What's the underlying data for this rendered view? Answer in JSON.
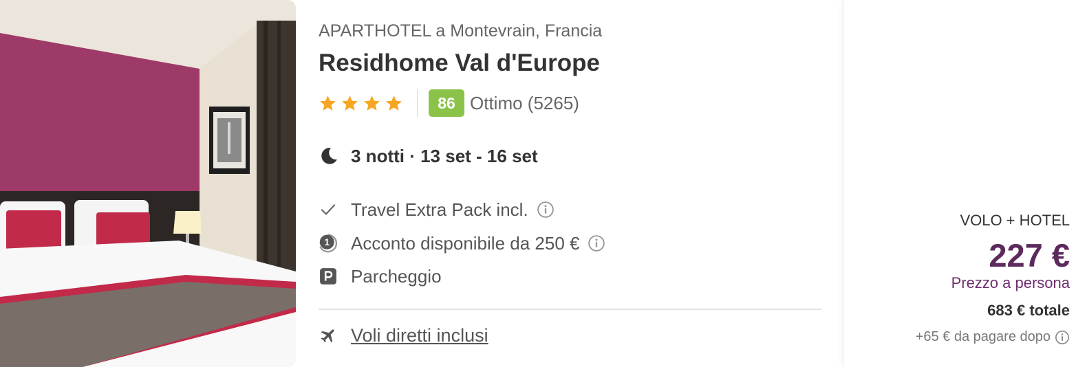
{
  "hotel": {
    "type_location": "APARTHOTEL a Montevrain, Francia",
    "name": "Residhome Val d'Europe",
    "stars": 4,
    "star_color": "#f5a623",
    "score": "86",
    "score_color": "#8bc34a",
    "score_label": "Ottimo (5265)",
    "stay": "3 notti · 13 set - 16 set",
    "stay_icon": "moon-icon"
  },
  "features": [
    {
      "icon": "check-icon",
      "label": "Travel Extra Pack incl.",
      "has_info": true
    },
    {
      "icon": "deposit-icon",
      "label": "Acconto disponibile da 250 €",
      "has_info": true
    },
    {
      "icon": "parking-icon",
      "label": "Parcheggio",
      "has_info": false
    }
  ],
  "flights": {
    "icon": "plane-icon",
    "label": "Voli diretti inclusi"
  },
  "pricing": {
    "package": "VOLO + HOTEL",
    "price": "227 €",
    "per_person": "Prezzo a persona",
    "total": "683 € totale",
    "extra": "+65 € da pagare dopo",
    "price_color": "#5c2a5c"
  }
}
